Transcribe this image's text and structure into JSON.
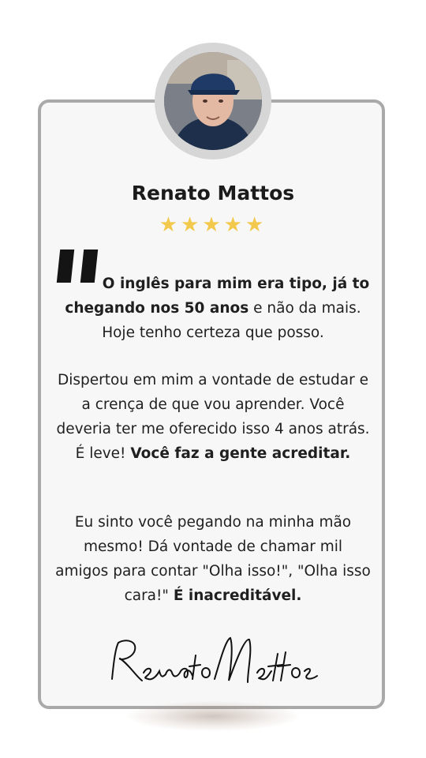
{
  "testimonial": {
    "author_name": "Renato Mattos",
    "rating": 5,
    "stars_text": "★★★★★",
    "paragraph1": {
      "bold_a": "O inglês para mim era tipo, já to chegando nos 50 anos",
      "normal_a": " e não da mais. Hoje tenho certeza que posso."
    },
    "paragraph2": {
      "normal_a": "Dispertou em mim a vontade de estudar e a crença de que vou aprender. Você deveria ter me oferecido isso 4 anos atrás. É leve! ",
      "bold_a": "Você faz a gente acreditar."
    },
    "paragraph3": {
      "normal_a": "Eu sinto você pegando na minha mão mesmo! Dá vontade de chamar mil amigos para contar \"Olha isso!\", \"Olha isso cara!\" ",
      "bold_a": "É inacreditável."
    },
    "signature_text": "Renato Mattos"
  },
  "colors": {
    "card_border": "#a9a9a9",
    "card_background": "#f7f7f7",
    "star": "#f2c94c",
    "text": "#1f1f1f"
  }
}
